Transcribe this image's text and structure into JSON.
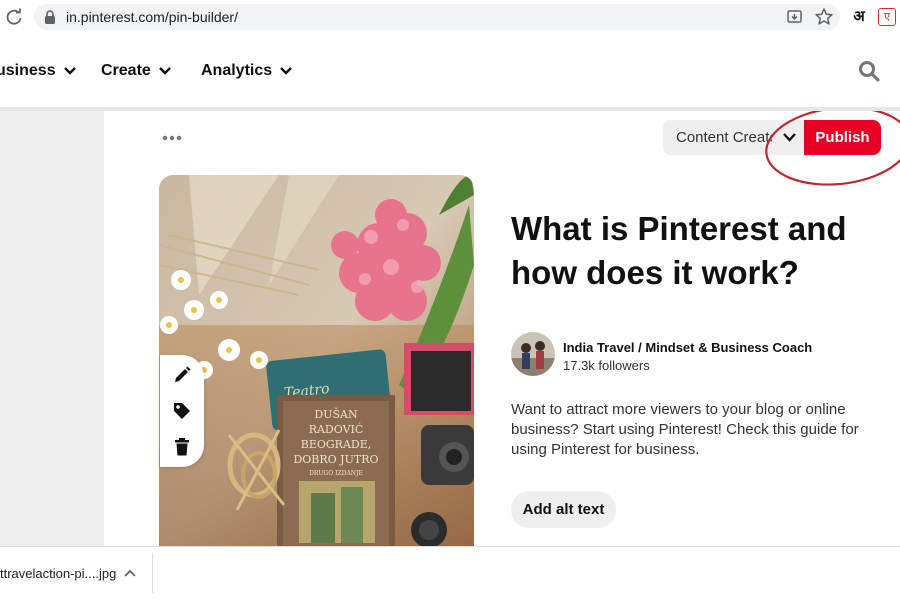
{
  "browser": {
    "url": "in.pinterest.com/pin-builder/",
    "extension_1_glyph": "अ",
    "extension_2_glyph": "ए"
  },
  "nav": {
    "items": [
      {
        "label": "usiness"
      },
      {
        "label": "Create"
      },
      {
        "label": "Analytics"
      }
    ]
  },
  "builder": {
    "board_name": "Content Creators",
    "publish_label": "Publish",
    "accent_color": "#e60023",
    "annotation_color": "#c0272d"
  },
  "pin": {
    "title": "What is Pinterest and how does it work?",
    "profile_name": "India Travel / Mindset & Business Coach",
    "followers": "17.3k followers",
    "description": "Want to attract more viewers to your blog or online business? Start using Pinterest! Check this guide for using Pinterest for business.",
    "alt_text_label": "Add alt text",
    "book_author": "DUŠAN",
    "book_title_1": "RADOVIĆ",
    "book_title_2": "BEOGRADE,",
    "book_title_3": "DOBRO JUTRO",
    "book_edition": "DRUGO IZDANJE",
    "tin_label": "Teatro"
  },
  "download": {
    "filename": "ttravelaction-pi....jpg"
  }
}
